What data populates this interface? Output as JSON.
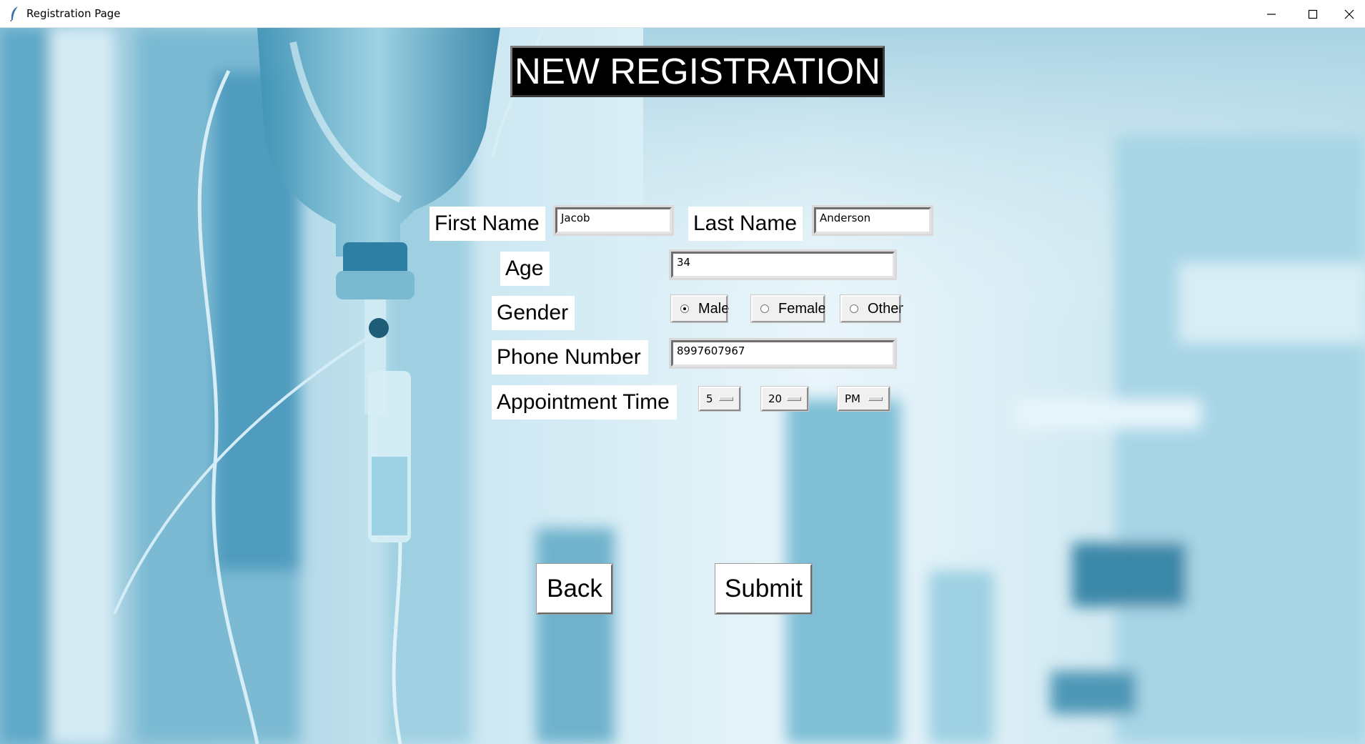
{
  "window": {
    "title": "Registration Page",
    "controls": [
      "minimize-icon",
      "maximize-icon",
      "close-icon"
    ]
  },
  "heading": "NEW REGISTRATION",
  "form": {
    "first_name_label": "First Name",
    "first_name_value": "Jacob",
    "last_name_label": "Last Name",
    "last_name_value": "Anderson",
    "age_label": "Age",
    "age_value": "34",
    "gender_label": "Gender",
    "gender_options": [
      "Male",
      "Female",
      "Other"
    ],
    "gender_selected": "Male",
    "phone_label": "Phone Number",
    "phone_value": "8997607967",
    "appointment_label": "Appointment Time",
    "appointment_hour": "5",
    "appointment_minute": "20",
    "appointment_ampm": "PM"
  },
  "buttons": {
    "back": "Back",
    "submit": "Submit"
  },
  "colors": {
    "heading_bg": "#000000",
    "heading_fg": "#ffffff",
    "background_tint": "#bfe1ee"
  }
}
